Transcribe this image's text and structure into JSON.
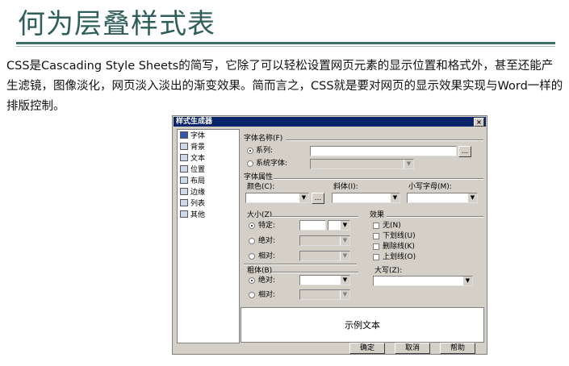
{
  "slide": {
    "title": "何为层叠样式表",
    "paragraph": "CSS是Cascading Style Sheets的简写，它除了可以轻松设置网页元素的显示位置和格式外，甚至还能产生滤镜，图像淡化，网页淡入淡出的渐变效果。简而言之，CSS就是要对网页的显示效果实现与Word一样的排版控制。"
  },
  "dialog": {
    "title": "样式生成器",
    "close_glyph": "×",
    "categories": [
      {
        "label": "字体",
        "icon": "font-icon"
      },
      {
        "label": "背景",
        "icon": "background-icon"
      },
      {
        "label": "文本",
        "icon": "text-icon"
      },
      {
        "label": "位置",
        "icon": "position-icon"
      },
      {
        "label": "布局",
        "icon": "layout-icon"
      },
      {
        "label": "边缘",
        "icon": "border-icon"
      },
      {
        "label": "列表",
        "icon": "list-icon"
      },
      {
        "label": "其他",
        "icon": "other-icon"
      }
    ],
    "font_name": {
      "group": "字体名称(F)",
      "family_radio": "系列:",
      "family_value": "",
      "browse": "...",
      "system_radio": "系统字体:"
    },
    "font_attr": {
      "group": "字体属性",
      "color": "颜色(C):",
      "color_browse": "...",
      "italic": "斜体(I):",
      "smallcaps": "小写字母(M):"
    },
    "size": {
      "group": "大小(Z)",
      "specific": "特定:",
      "absolute": "绝对:",
      "relative": "相对:"
    },
    "effects": {
      "group": "效果",
      "none": "无(N)",
      "underline": "下划线(U)",
      "strikethrough": "删除线(K)",
      "overline": "上划线(O)"
    },
    "weight": {
      "group": "粗体(B)",
      "absolute": "绝对:",
      "relative": "相对:"
    },
    "capitalization": {
      "group": "大写(Z):"
    },
    "preview_text": "示例文本",
    "buttons": {
      "ok": "确定",
      "cancel": "取消",
      "help": "帮助"
    },
    "combo_arrow": "▼"
  }
}
